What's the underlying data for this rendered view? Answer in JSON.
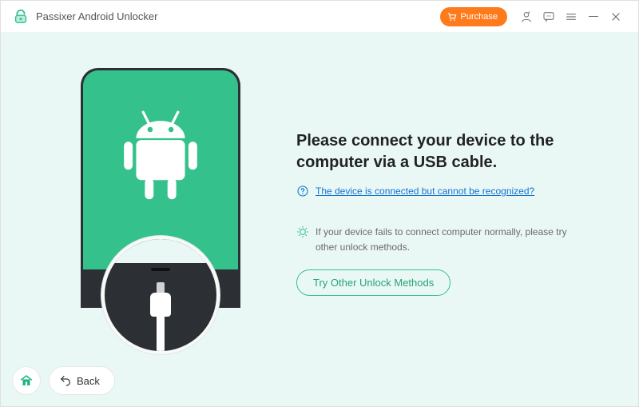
{
  "app": {
    "title": "Passixer Android Unlocker"
  },
  "titlebar": {
    "purchase_label": "Purchase"
  },
  "main": {
    "heading": "Please connect your device to the computer via a USB cable.",
    "help_link": "The device is connected but cannot be recognized?",
    "tip_text": "If your device fails to connect computer normally, please try other unlock methods.",
    "other_methods_btn": "Try Other Unlock Methods"
  },
  "footer": {
    "back_label": "Back"
  },
  "colors": {
    "accent": "#34c18b",
    "purchase": "#ff7a1a",
    "link": "#1272d4"
  }
}
